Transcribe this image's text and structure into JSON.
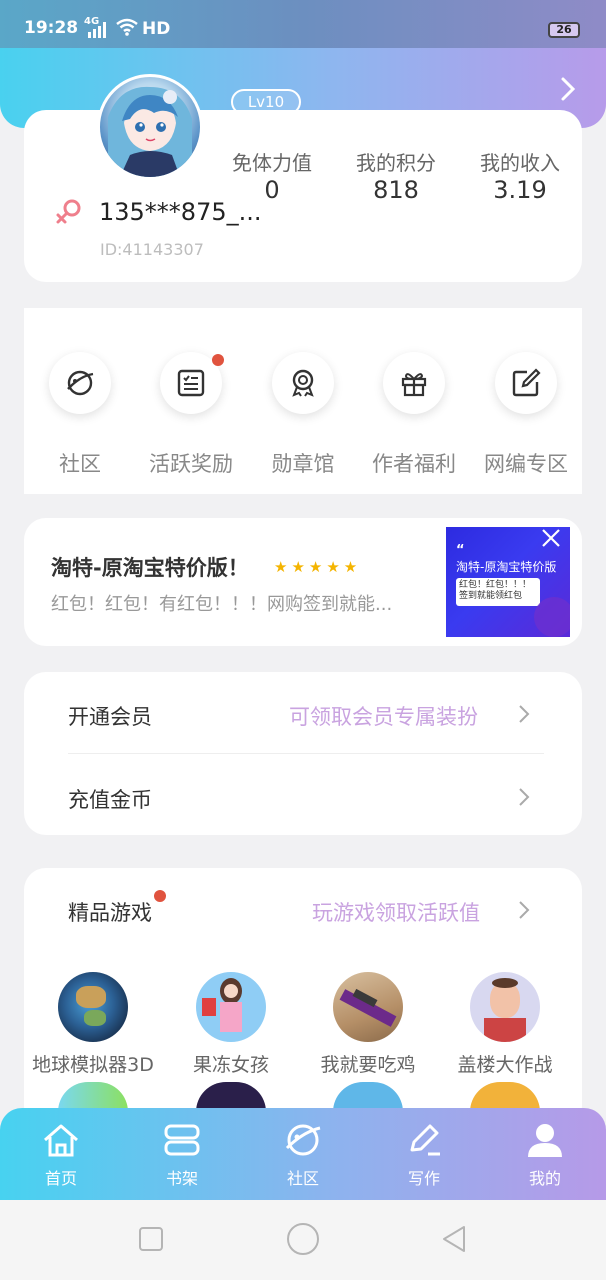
{
  "status_bar": {
    "time": "19:28",
    "network": "4G",
    "hd": "HD",
    "battery": "26"
  },
  "profile": {
    "level": "Lv10",
    "username": "135***875_...",
    "user_id": "ID:41143307",
    "stats": [
      {
        "label": "免体力值",
        "value": "0"
      },
      {
        "label": "我的积分",
        "value": "818"
      },
      {
        "label": "我的收入",
        "value": "3.19"
      }
    ]
  },
  "menu": {
    "items": [
      {
        "label": "社区",
        "icon": "planet-icon"
      },
      {
        "label": "活跃奖励",
        "icon": "checklist-icon"
      },
      {
        "label": "勋章馆",
        "icon": "medal-icon"
      },
      {
        "label": "作者福利",
        "icon": "gift-icon"
      },
      {
        "label": "网编专区",
        "icon": "edit-icon"
      }
    ]
  },
  "ad": {
    "title": "淘特-原淘宝特价版！",
    "stars": "★★★★★",
    "description": "红包！红包！有红包！！！网购签到就能...",
    "image_title": "淘特-原淘宝特价版",
    "image_subtitle": "红包！红包！！！签到就能领红包",
    "image_quote": "“"
  },
  "vip": {
    "open_label": "开通会员",
    "open_hint": "可领取会员专属装扮",
    "recharge_label": "充值金币"
  },
  "games": {
    "title": "精品游戏",
    "hint": "玩游戏领取活跃值",
    "items": [
      {
        "name": "地球模拟器3D"
      },
      {
        "name": "果冻女孩"
      },
      {
        "name": "我就要吃鸡"
      },
      {
        "name": "盖楼大作战"
      }
    ]
  },
  "bottom_nav": {
    "items": [
      {
        "label": "首页",
        "icon": "home-icon"
      },
      {
        "label": "书架",
        "icon": "bookshelf-icon"
      },
      {
        "label": "社区",
        "icon": "planet-icon"
      },
      {
        "label": "写作",
        "icon": "pen-icon"
      },
      {
        "label": "我的",
        "icon": "user-icon"
      }
    ]
  },
  "colors": {
    "accent": "#49d1ef",
    "purple": "#b79bea",
    "hint": "#c9a3e0",
    "badge": "#e0533e"
  }
}
